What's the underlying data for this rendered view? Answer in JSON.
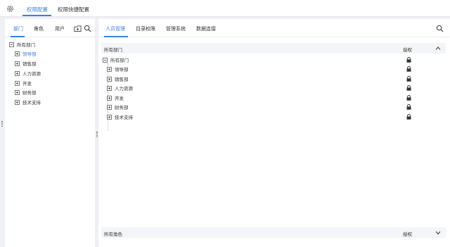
{
  "top_tabs": [
    {
      "label": "权限配置",
      "active": true
    },
    {
      "label": "权限快捷配置",
      "active": false
    }
  ],
  "left": {
    "tabs": [
      {
        "label": "部门",
        "active": true
      },
      {
        "label": "角色",
        "active": false
      },
      {
        "label": "用户",
        "active": false
      }
    ],
    "tree": {
      "root": "所有部门",
      "children": [
        "领导部",
        "销售部",
        "人力资源",
        "开发",
        "财务部",
        "技术支持"
      ],
      "selected": "领导部"
    }
  },
  "right": {
    "tabs": [
      {
        "label": "人员管理",
        "active": true
      },
      {
        "label": "目录权限",
        "active": false
      },
      {
        "label": "管理系统",
        "active": false
      },
      {
        "label": "数据连接",
        "active": false
      }
    ],
    "dept_section": {
      "title": "所有部门",
      "auth_label": "授权",
      "expanded": true
    },
    "dept_tree": {
      "root": "所有部门",
      "children": [
        "领导部",
        "销售部",
        "人力资源",
        "开发",
        "财务部",
        "技术支持"
      ]
    },
    "role_section": {
      "title": "所有角色",
      "auth_label": "授权",
      "expanded": false
    }
  },
  "icons": {
    "settings": "gear-icon",
    "new_folder": "folder-icon",
    "search": "search-icon",
    "lock": "lock-icon",
    "collapse": "chevron-up-icon",
    "expand": "chevron-down-icon"
  },
  "colors": {
    "accent": "#3d7fe0",
    "background": "#eef0f3",
    "section": "#f3f5f8"
  }
}
